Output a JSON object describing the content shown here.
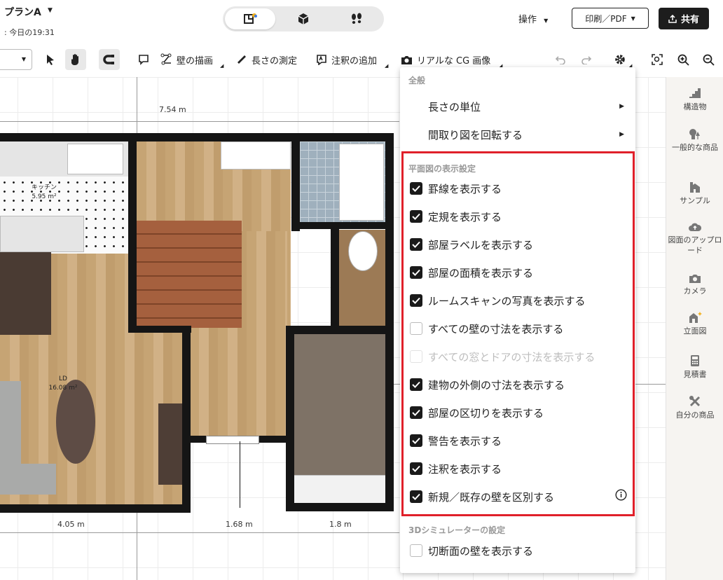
{
  "header": {
    "plan_name": "プランA",
    "plan_subtitle": ": 今日の19:31",
    "operations_label": "操作",
    "print_label": "印刷／PDF",
    "share_label": "共有"
  },
  "toolbar": {
    "draw_wall": "壁の描画",
    "measure": "長さの測定",
    "add_note": "注釈の追加",
    "realistic_cg": "リアルな CG 画像"
  },
  "canvas": {
    "dim_top": "7.54 m",
    "dim_bottom_1": "4.05 m",
    "dim_bottom_2": "1.68 m",
    "dim_bottom_3": "1.8 m",
    "kitchen_name": "キッチン",
    "kitchen_area": "5.95 m²",
    "ld_name": "LD",
    "ld_area": "16.08 m²"
  },
  "menu": {
    "general_title": "全般",
    "length_unit": "長さの単位",
    "rotate_plan": "間取り図を回転する",
    "plan_display_title": "平面図の表示設定",
    "options": [
      {
        "label": "罫線を表示する",
        "state": "checked"
      },
      {
        "label": "定規を表示する",
        "state": "checked"
      },
      {
        "label": "部屋ラベルを表示する",
        "state": "checked"
      },
      {
        "label": "部屋の面積を表示する",
        "state": "checked"
      },
      {
        "label": "ルームスキャンの写真を表示する",
        "state": "checked"
      },
      {
        "label": "すべての壁の寸法を表示する",
        "state": "unchecked"
      },
      {
        "label": "すべての窓とドアの寸法を表示する",
        "state": "disabled"
      },
      {
        "label": "建物の外側の寸法を表示する",
        "state": "checked"
      },
      {
        "label": "部屋の区切りを表示する",
        "state": "checked"
      },
      {
        "label": "警告を表示する",
        "state": "checked"
      },
      {
        "label": "注釈を表示する",
        "state": "checked"
      },
      {
        "label": "新規／既存の壁を区別する",
        "state": "checked"
      }
    ],
    "sim3d_title": "3Dシミュレーターの設定",
    "sim3d_option": "切断面の壁を表示する"
  },
  "right_panel": {
    "items": [
      "構造物",
      "一般的な商品",
      "サンプル",
      "図面のアップロード",
      "カメラ",
      "立面図",
      "見積書",
      "自分の商品"
    ]
  },
  "colors": {
    "highlight": "#e0202a",
    "accent_star": "#f2b01e"
  }
}
